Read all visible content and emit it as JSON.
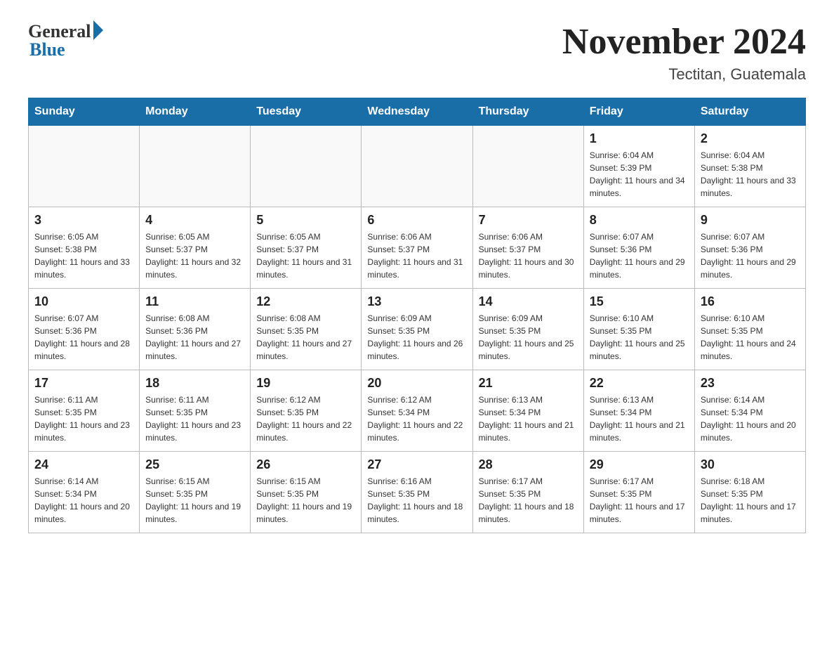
{
  "header": {
    "logo_general": "General",
    "logo_blue": "Blue",
    "month_title": "November 2024",
    "location": "Tectitan, Guatemala"
  },
  "weekdays": [
    "Sunday",
    "Monday",
    "Tuesday",
    "Wednesday",
    "Thursday",
    "Friday",
    "Saturday"
  ],
  "weeks": [
    [
      {
        "day": "",
        "sunrise": "",
        "sunset": "",
        "daylight": ""
      },
      {
        "day": "",
        "sunrise": "",
        "sunset": "",
        "daylight": ""
      },
      {
        "day": "",
        "sunrise": "",
        "sunset": "",
        "daylight": ""
      },
      {
        "day": "",
        "sunrise": "",
        "sunset": "",
        "daylight": ""
      },
      {
        "day": "",
        "sunrise": "",
        "sunset": "",
        "daylight": ""
      },
      {
        "day": "1",
        "sunrise": "Sunrise: 6:04 AM",
        "sunset": "Sunset: 5:39 PM",
        "daylight": "Daylight: 11 hours and 34 minutes."
      },
      {
        "day": "2",
        "sunrise": "Sunrise: 6:04 AM",
        "sunset": "Sunset: 5:38 PM",
        "daylight": "Daylight: 11 hours and 33 minutes."
      }
    ],
    [
      {
        "day": "3",
        "sunrise": "Sunrise: 6:05 AM",
        "sunset": "Sunset: 5:38 PM",
        "daylight": "Daylight: 11 hours and 33 minutes."
      },
      {
        "day": "4",
        "sunrise": "Sunrise: 6:05 AM",
        "sunset": "Sunset: 5:37 PM",
        "daylight": "Daylight: 11 hours and 32 minutes."
      },
      {
        "day": "5",
        "sunrise": "Sunrise: 6:05 AM",
        "sunset": "Sunset: 5:37 PM",
        "daylight": "Daylight: 11 hours and 31 minutes."
      },
      {
        "day": "6",
        "sunrise": "Sunrise: 6:06 AM",
        "sunset": "Sunset: 5:37 PM",
        "daylight": "Daylight: 11 hours and 31 minutes."
      },
      {
        "day": "7",
        "sunrise": "Sunrise: 6:06 AM",
        "sunset": "Sunset: 5:37 PM",
        "daylight": "Daylight: 11 hours and 30 minutes."
      },
      {
        "day": "8",
        "sunrise": "Sunrise: 6:07 AM",
        "sunset": "Sunset: 5:36 PM",
        "daylight": "Daylight: 11 hours and 29 minutes."
      },
      {
        "day": "9",
        "sunrise": "Sunrise: 6:07 AM",
        "sunset": "Sunset: 5:36 PM",
        "daylight": "Daylight: 11 hours and 29 minutes."
      }
    ],
    [
      {
        "day": "10",
        "sunrise": "Sunrise: 6:07 AM",
        "sunset": "Sunset: 5:36 PM",
        "daylight": "Daylight: 11 hours and 28 minutes."
      },
      {
        "day": "11",
        "sunrise": "Sunrise: 6:08 AM",
        "sunset": "Sunset: 5:36 PM",
        "daylight": "Daylight: 11 hours and 27 minutes."
      },
      {
        "day": "12",
        "sunrise": "Sunrise: 6:08 AM",
        "sunset": "Sunset: 5:35 PM",
        "daylight": "Daylight: 11 hours and 27 minutes."
      },
      {
        "day": "13",
        "sunrise": "Sunrise: 6:09 AM",
        "sunset": "Sunset: 5:35 PM",
        "daylight": "Daylight: 11 hours and 26 minutes."
      },
      {
        "day": "14",
        "sunrise": "Sunrise: 6:09 AM",
        "sunset": "Sunset: 5:35 PM",
        "daylight": "Daylight: 11 hours and 25 minutes."
      },
      {
        "day": "15",
        "sunrise": "Sunrise: 6:10 AM",
        "sunset": "Sunset: 5:35 PM",
        "daylight": "Daylight: 11 hours and 25 minutes."
      },
      {
        "day": "16",
        "sunrise": "Sunrise: 6:10 AM",
        "sunset": "Sunset: 5:35 PM",
        "daylight": "Daylight: 11 hours and 24 minutes."
      }
    ],
    [
      {
        "day": "17",
        "sunrise": "Sunrise: 6:11 AM",
        "sunset": "Sunset: 5:35 PM",
        "daylight": "Daylight: 11 hours and 23 minutes."
      },
      {
        "day": "18",
        "sunrise": "Sunrise: 6:11 AM",
        "sunset": "Sunset: 5:35 PM",
        "daylight": "Daylight: 11 hours and 23 minutes."
      },
      {
        "day": "19",
        "sunrise": "Sunrise: 6:12 AM",
        "sunset": "Sunset: 5:35 PM",
        "daylight": "Daylight: 11 hours and 22 minutes."
      },
      {
        "day": "20",
        "sunrise": "Sunrise: 6:12 AM",
        "sunset": "Sunset: 5:34 PM",
        "daylight": "Daylight: 11 hours and 22 minutes."
      },
      {
        "day": "21",
        "sunrise": "Sunrise: 6:13 AM",
        "sunset": "Sunset: 5:34 PM",
        "daylight": "Daylight: 11 hours and 21 minutes."
      },
      {
        "day": "22",
        "sunrise": "Sunrise: 6:13 AM",
        "sunset": "Sunset: 5:34 PM",
        "daylight": "Daylight: 11 hours and 21 minutes."
      },
      {
        "day": "23",
        "sunrise": "Sunrise: 6:14 AM",
        "sunset": "Sunset: 5:34 PM",
        "daylight": "Daylight: 11 hours and 20 minutes."
      }
    ],
    [
      {
        "day": "24",
        "sunrise": "Sunrise: 6:14 AM",
        "sunset": "Sunset: 5:34 PM",
        "daylight": "Daylight: 11 hours and 20 minutes."
      },
      {
        "day": "25",
        "sunrise": "Sunrise: 6:15 AM",
        "sunset": "Sunset: 5:35 PM",
        "daylight": "Daylight: 11 hours and 19 minutes."
      },
      {
        "day": "26",
        "sunrise": "Sunrise: 6:15 AM",
        "sunset": "Sunset: 5:35 PM",
        "daylight": "Daylight: 11 hours and 19 minutes."
      },
      {
        "day": "27",
        "sunrise": "Sunrise: 6:16 AM",
        "sunset": "Sunset: 5:35 PM",
        "daylight": "Daylight: 11 hours and 18 minutes."
      },
      {
        "day": "28",
        "sunrise": "Sunrise: 6:17 AM",
        "sunset": "Sunset: 5:35 PM",
        "daylight": "Daylight: 11 hours and 18 minutes."
      },
      {
        "day": "29",
        "sunrise": "Sunrise: 6:17 AM",
        "sunset": "Sunset: 5:35 PM",
        "daylight": "Daylight: 11 hours and 17 minutes."
      },
      {
        "day": "30",
        "sunrise": "Sunrise: 6:18 AM",
        "sunset": "Sunset: 5:35 PM",
        "daylight": "Daylight: 11 hours and 17 minutes."
      }
    ]
  ]
}
